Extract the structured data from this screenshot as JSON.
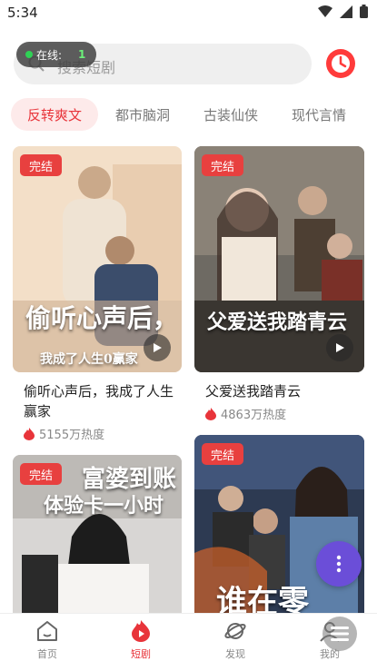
{
  "status_bar": {
    "time": "5:34"
  },
  "search": {
    "placeholder": "搜索短剧"
  },
  "online": {
    "label": "在线:",
    "count": "1"
  },
  "tabs": [
    "反转爽文",
    "都市脑洞",
    "古装仙侠",
    "现代言情"
  ],
  "badge_done": "完结",
  "dramas": [
    {
      "title": "偷听心声后，我成了人生赢家",
      "heat": "5155万热度",
      "poster_text": "偷听心声后，",
      "poster_sub": "我成了人生0赢家"
    },
    {
      "title": "父爱送我踏青云",
      "heat": "4863万热度",
      "poster_text": "父爱送我踏青云"
    },
    {
      "poster_text": "富婆到账",
      "poster_sub": "体验卡一小时"
    },
    {
      "poster_text": "谁在零"
    }
  ],
  "nav": [
    {
      "label": "首页",
      "icon": "home-icon"
    },
    {
      "label": "短剧",
      "icon": "flame-icon"
    },
    {
      "label": "发现",
      "icon": "planet-icon"
    },
    {
      "label": "我的",
      "icon": "user-icon"
    }
  ],
  "colors": {
    "accent": "#e8343a",
    "fab": "#6b4ed8"
  }
}
